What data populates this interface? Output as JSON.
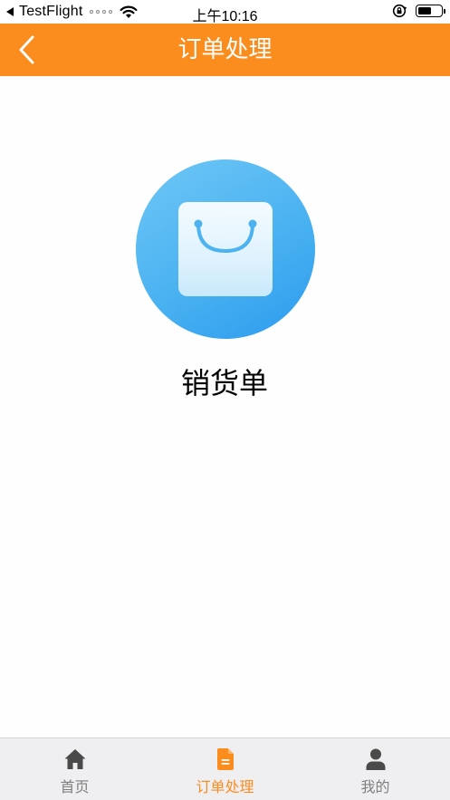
{
  "status_bar": {
    "carrier": "TestFlight",
    "time": "上午10:16"
  },
  "nav": {
    "title": "订单处理",
    "back_icon": "chevron-left-icon"
  },
  "main": {
    "items": [
      {
        "label": "销货单",
        "icon": "shopping-bag-icon"
      }
    ]
  },
  "tab_bar": {
    "tabs": [
      {
        "label": "首页",
        "icon": "home-icon",
        "active": false
      },
      {
        "label": "订单处理",
        "icon": "document-icon",
        "active": true
      },
      {
        "label": "我的",
        "icon": "person-icon",
        "active": false
      }
    ]
  },
  "colors": {
    "accent": "#fb8c1e",
    "icon_blue": "#3aa8f2",
    "tab_inactive": "#7f7f7f",
    "tab_inactive_icon": "#4a4a4a"
  }
}
